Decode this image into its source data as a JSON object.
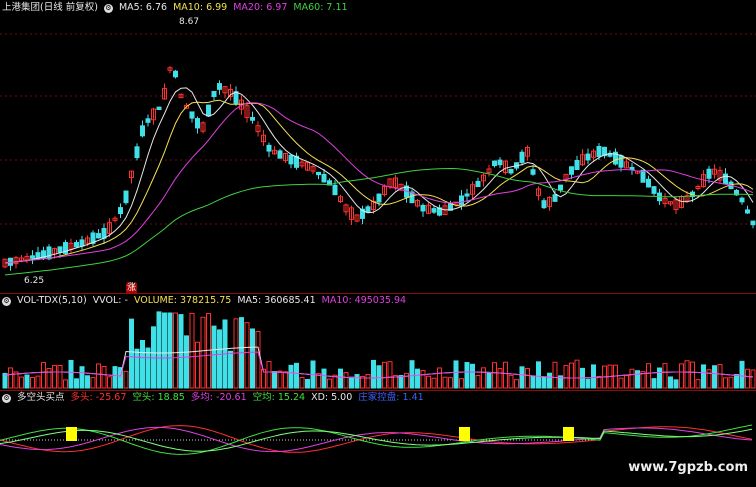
{
  "price_panel": {
    "title": "上港集团(日线 前复权)",
    "ma": [
      {
        "label": "MA5: 6.76",
        "color": "#e8e8e8"
      },
      {
        "label": "MA10: 6.99",
        "color": "#f5e050"
      },
      {
        "label": "MA20: 6.97",
        "color": "#e040e0"
      },
      {
        "label": "MA60: 7.11",
        "color": "#40d040"
      }
    ],
    "high_label": "8.67",
    "low_label": "6.25",
    "flag_label": "涨"
  },
  "volume_panel": {
    "title": "VOL-TDX(5,10)",
    "vvol": "VVOL: -",
    "volume": "VOLUME: 378215.75",
    "ma5": "MA5: 360685.41",
    "ma10": "MA10: 495035.94",
    "colors": {
      "volume": "#f5e050",
      "ma5": "#e8e8e8",
      "ma10": "#e040e0"
    }
  },
  "indicator_panel": {
    "title": "多空头买点",
    "items": [
      {
        "label": "多头: -25.67",
        "color": "#ff3030"
      },
      {
        "label": "空头: 18.85",
        "color": "#40e040"
      },
      {
        "label": "多均: -20.61",
        "color": "#e040e0"
      },
      {
        "label": "空均: 15.24",
        "color": "#40e040"
      },
      {
        "label": "XD: 5.00",
        "color": "#e8e8e8"
      },
      {
        "label": "庄家控盘: 1.41",
        "color": "#4060ff"
      }
    ]
  },
  "colors": {
    "up": "#ff3030",
    "down": "#40e0e8",
    "bg": "#000000",
    "grid": "#8a1010",
    "signal": "#ffff00"
  },
  "watermark": "www.7gpzb.com"
}
